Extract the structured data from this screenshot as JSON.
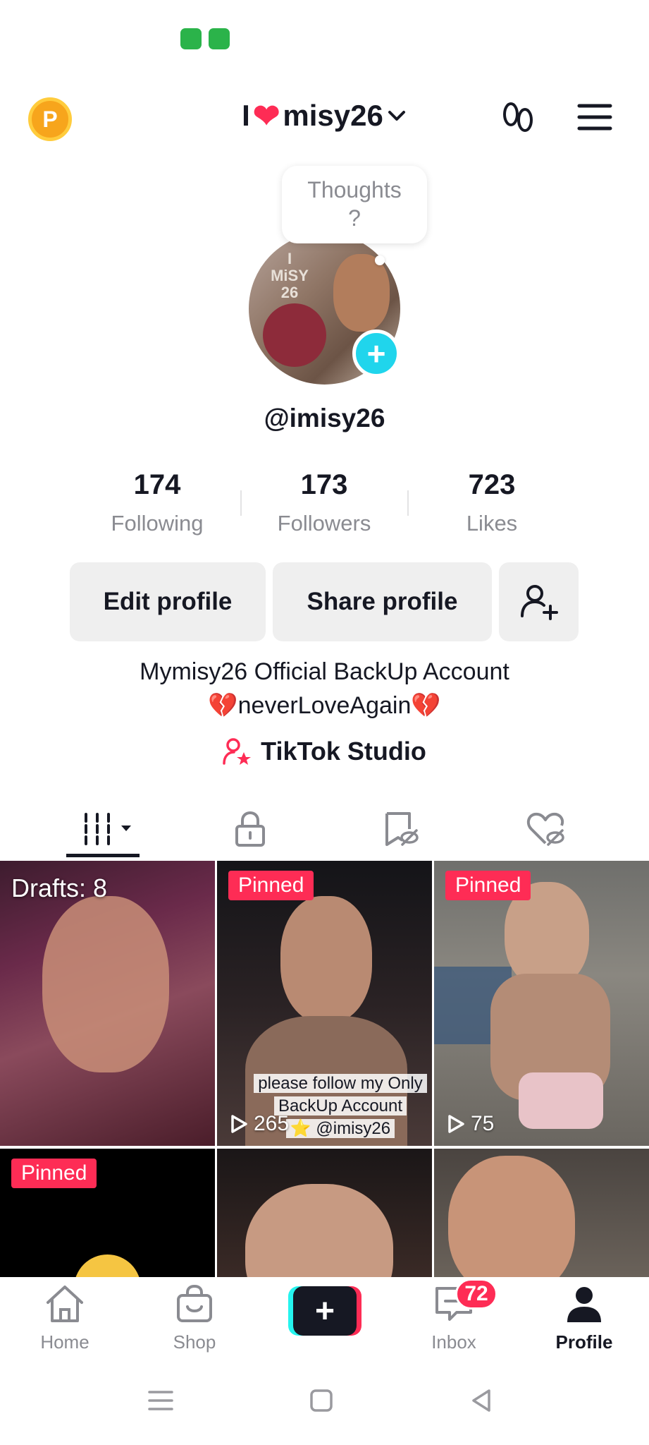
{
  "header": {
    "coin_letter": "P",
    "title_prefix": "I",
    "title_heart": "❤",
    "title_name": "misy26"
  },
  "profile": {
    "thought_bubble_line1": "Thoughts",
    "thought_bubble_line2": "?",
    "avatar_text": "I\nMiSY\n26",
    "username": "@imisy26",
    "stats": [
      {
        "value": "174",
        "label": "Following"
      },
      {
        "value": "173",
        "label": "Followers"
      },
      {
        "value": "723",
        "label": "Likes"
      }
    ],
    "edit_button": "Edit profile",
    "share_button": "Share profile",
    "bio_line1": "Mymisy26 Official BackUp Account",
    "bio_line2": "💔neverLoveAgain💔",
    "studio_link": "TikTok Studio"
  },
  "videos": [
    {
      "label": "Drafts: 8"
    },
    {
      "pinned": "Pinned",
      "views": "265",
      "caption": [
        "please follow my Only",
        "BackUp Account",
        "⭐ @imisy26"
      ]
    },
    {
      "pinned": "Pinned",
      "views": "75"
    },
    {
      "pinned": "Pinned"
    },
    {},
    {}
  ],
  "nav": {
    "home": "Home",
    "shop": "Shop",
    "create": "+",
    "inbox": "Inbox",
    "inbox_badge": "72",
    "profile": "Profile"
  },
  "colors": {
    "accent": "#fe2c55",
    "teal": "#20d5ec",
    "text": "#161823",
    "muted": "#8a8b91"
  }
}
